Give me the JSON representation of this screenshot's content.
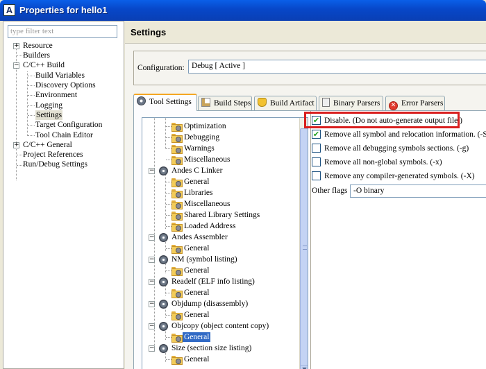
{
  "window": {
    "title": "Properties for hello1",
    "icon": "app-logo-icon"
  },
  "filter": {
    "placeholder": "type filter text"
  },
  "sidebar": {
    "items": [
      {
        "label": "Resource",
        "expander": "+"
      },
      {
        "label": "Builders"
      },
      {
        "label": "C/C++ Build",
        "expander": "-"
      },
      {
        "label": "Build Variables"
      },
      {
        "label": "Discovery Options"
      },
      {
        "label": "Environment"
      },
      {
        "label": "Logging"
      },
      {
        "label": "Settings",
        "selected": true
      },
      {
        "label": "Target Configuration"
      },
      {
        "label": "Tool Chain Editor"
      },
      {
        "label": "C/C++ General",
        "expander": "+"
      },
      {
        "label": "Project References"
      },
      {
        "label": "Run/Debug Settings"
      }
    ]
  },
  "main": {
    "title": "Settings",
    "configuration": {
      "label": "Configuration:",
      "value": "Debug  [ Active ]"
    },
    "tabs": [
      {
        "label": "Tool Settings",
        "icon": "gear-icon",
        "active": true
      },
      {
        "label": "Build Steps",
        "icon": "build-steps-icon"
      },
      {
        "label": "Build Artifact",
        "icon": "trophy-icon"
      },
      {
        "label": "Binary Parsers",
        "icon": "binary-icon"
      },
      {
        "label": "Error Parsers",
        "icon": "error-icon"
      }
    ]
  },
  "tool_tree": {
    "items": [
      {
        "label": "Optimization"
      },
      {
        "label": "Debugging"
      },
      {
        "label": "Warnings"
      },
      {
        "label": "Miscellaneous"
      },
      {
        "label": "Andes C Linker"
      },
      {
        "label": "General"
      },
      {
        "label": "Libraries"
      },
      {
        "label": "Miscellaneous"
      },
      {
        "label": "Shared Library Settings"
      },
      {
        "label": "Loaded Address"
      },
      {
        "label": "Andes Assembler"
      },
      {
        "label": "General"
      },
      {
        "label": "NM (symbol listing)"
      },
      {
        "label": "General"
      },
      {
        "label": "Readelf (ELF info listing)"
      },
      {
        "label": "General"
      },
      {
        "label": "Objdump (disassembly)"
      },
      {
        "label": "General"
      },
      {
        "label": "Objcopy (object content copy)"
      },
      {
        "label": "General",
        "selected": true
      },
      {
        "label": "Size (section size listing)"
      },
      {
        "label": "General"
      }
    ]
  },
  "options": {
    "checkboxes": [
      {
        "label": "Disable. (Do not auto-generate output file.)",
        "checked": true
      },
      {
        "label": "Remove all symbol and relocation information. (-S)",
        "checked": true
      },
      {
        "label": "Remove all debugging symbols sections. (-g)",
        "checked": false
      },
      {
        "label": "Remove all non-global symbols. (-x)",
        "checked": false
      },
      {
        "label": "Remove any compiler-generated symbols. (-X)",
        "checked": false
      }
    ],
    "other_flags": {
      "label": "Other flags",
      "value": "-O binary"
    },
    "highlight_color": "#d81e1e"
  }
}
